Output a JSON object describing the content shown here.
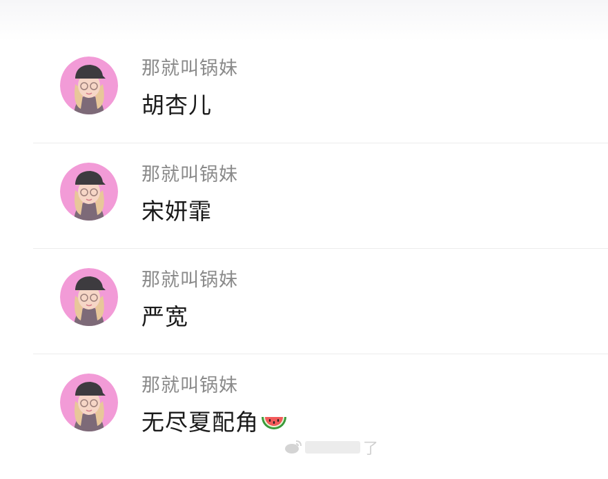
{
  "comments": [
    {
      "author": "那就叫锅妹",
      "text": "胡杏儿",
      "emoji": ""
    },
    {
      "author": "那就叫锅妹",
      "text": "宋妍霏",
      "emoji": ""
    },
    {
      "author": "那就叫锅妹",
      "text": "严宽",
      "emoji": ""
    },
    {
      "author": "那就叫锅妹",
      "text": "无尽夏配角",
      "emoji": "watermelon-icon"
    }
  ],
  "watermark": {
    "text": "了",
    "icon": "weibo-icon"
  },
  "colors": {
    "avatar_bg": "#f29bd7",
    "author": "#8a8a8a",
    "text": "#1a1a1a",
    "divider": "#ececec"
  }
}
